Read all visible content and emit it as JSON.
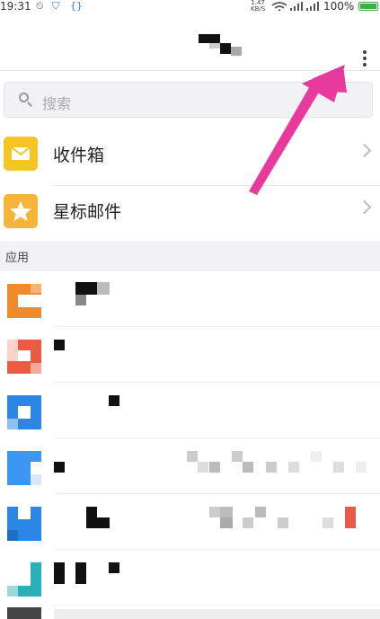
{
  "status_bar": {
    "time": "19:31",
    "network_speed": "1.47",
    "network_unit": "KB/S",
    "battery_pct": "100%"
  },
  "search": {
    "placeholder": "搜索"
  },
  "folders": [
    {
      "label": "收件箱",
      "icon": "inbox-envelope-icon",
      "color": "#f5c623"
    },
    {
      "label": "星标邮件",
      "icon": "star-icon",
      "color": "#f5b53b"
    }
  ],
  "apps_section": {
    "title": "应用"
  },
  "colors": {
    "accent_pink": "#e8399c",
    "app_orange": "#f08a2a",
    "app_red": "#ec5a44",
    "app_blue": "#2b86e6",
    "app_teal": "#2aaeb8"
  }
}
